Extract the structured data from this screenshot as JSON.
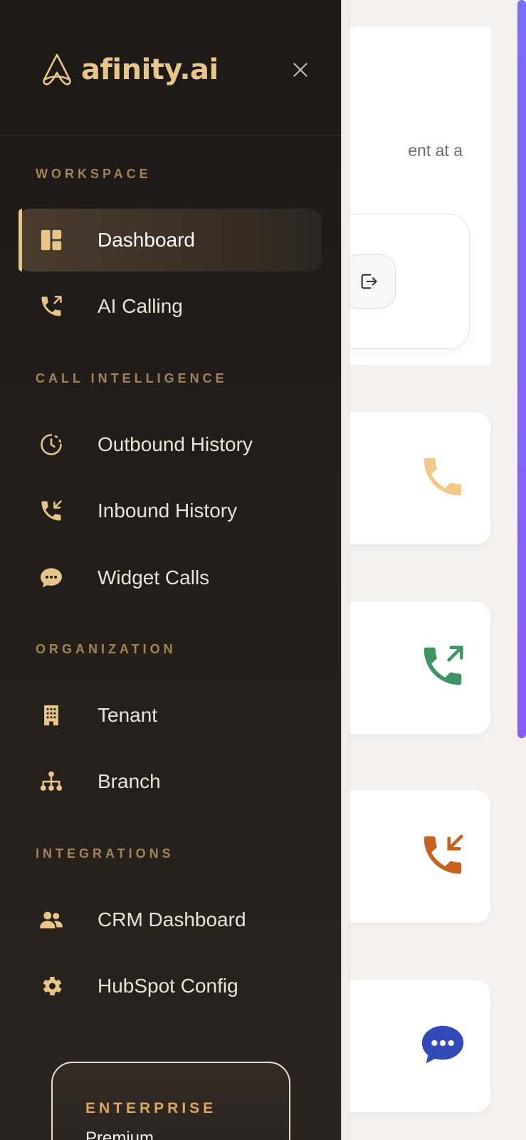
{
  "app": {
    "brand": "afinity.ai"
  },
  "background": {
    "subtitle_fragment": "ent at a",
    "stat_icons": [
      "phone-icon",
      "phone-outgoing-icon",
      "phone-incoming-icon",
      "chat-bubble-icon"
    ],
    "stat_icon_colors": [
      "#f0c98a",
      "#3f9466",
      "#c5621f",
      "#3349b8"
    ],
    "scrollbar_color": "#7b6ef2"
  },
  "sidebar": {
    "sections": [
      {
        "label": "WORKSPACE"
      },
      {
        "label": "CALL INTELLIGENCE"
      },
      {
        "label": "ORGANIZATION"
      },
      {
        "label": "INTEGRATIONS"
      }
    ],
    "items": [
      {
        "label": "Dashboard",
        "icon": "dashboard-icon",
        "active": true
      },
      {
        "label": "AI Calling",
        "icon": "phone-outgoing-icon",
        "active": false
      },
      {
        "label": "Outbound History",
        "icon": "clock-history-icon",
        "active": false
      },
      {
        "label": "Inbound History",
        "icon": "phone-incoming-icon",
        "active": false
      },
      {
        "label": "Widget Calls",
        "icon": "chat-bubble-icon",
        "active": false
      },
      {
        "label": "Tenant",
        "icon": "building-icon",
        "active": false
      },
      {
        "label": "Branch",
        "icon": "hierarchy-icon",
        "active": false
      },
      {
        "label": "CRM Dashboard",
        "icon": "users-icon",
        "active": false
      },
      {
        "label": "HubSpot Config",
        "icon": "gear-icon",
        "active": false
      }
    ],
    "plan": {
      "tier": "ENTERPRISE",
      "name": "Premium"
    },
    "accent_color": "#e7c68c"
  }
}
